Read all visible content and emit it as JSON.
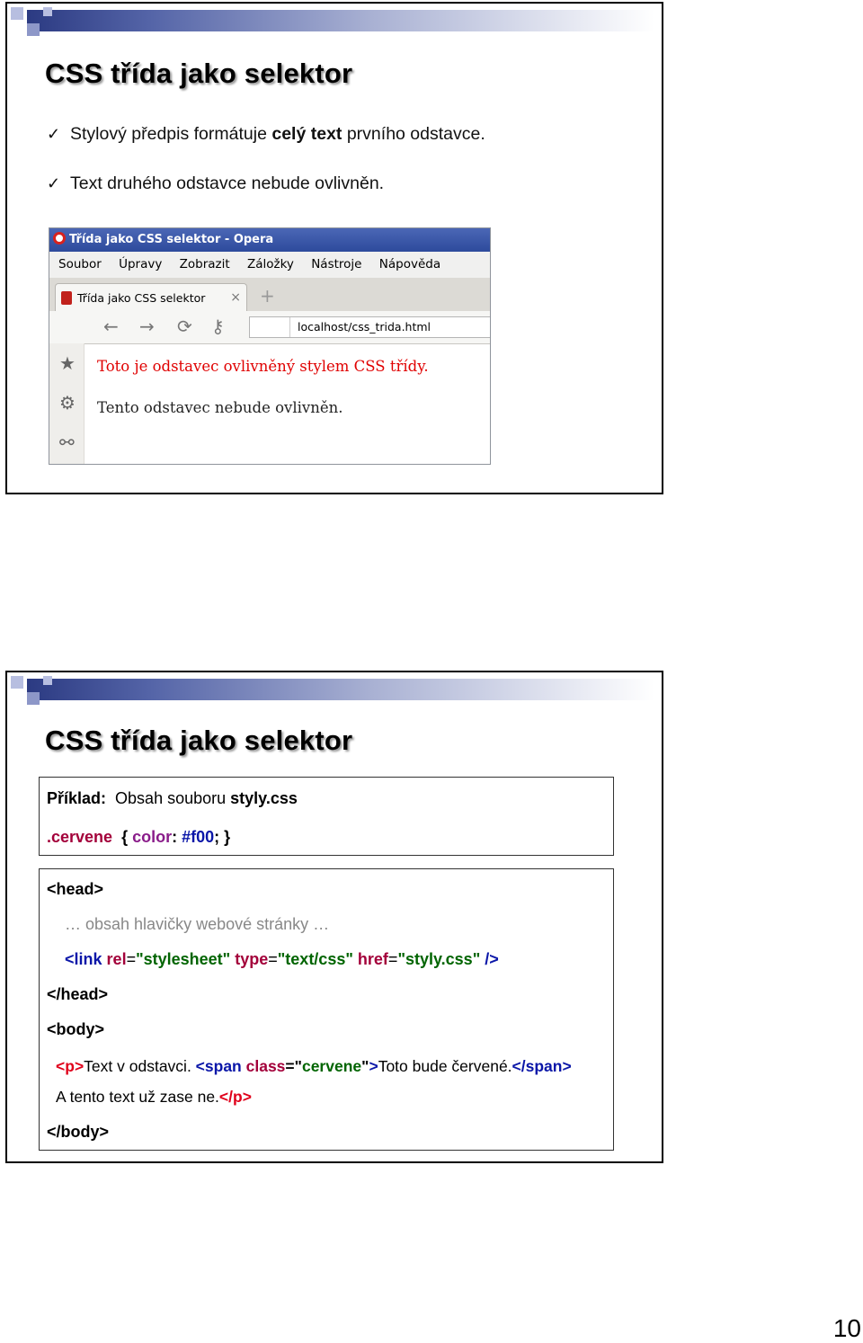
{
  "slide1": {
    "title": "CSS třída jako selektor",
    "bullet1": {
      "check": "✓",
      "pre": "Stylový předpis formátuje ",
      "bold": "celý text",
      "post": " prvního odstavce."
    },
    "bullet2": {
      "check": "✓",
      "text": "Text druhého odstavce nebude ovlivněn."
    },
    "browser": {
      "window_title": "Třída jako CSS selektor - Opera",
      "menu": [
        "Soubor",
        "Úpravy",
        "Zobrazit",
        "Záložky",
        "Nástroje",
        "Nápověda"
      ],
      "tab_label": "Třída jako CSS selektor",
      "tab_close": "×",
      "tab_new": "+",
      "address": "localhost/css_trida.html",
      "nav_icons": {
        "back": "←",
        "forward": "→",
        "reload": "⟳",
        "key": "⚷"
      },
      "side_icons": {
        "star": "★",
        "gear": "⚙",
        "share": "⚯"
      },
      "para_red": "Toto je odstavec ovlivněný stylem CSS třídy.",
      "para_normal": "Tento odstavec nebude ovlivněn."
    }
  },
  "slide2": {
    "title": "CSS třída jako selektor",
    "example": {
      "label": "Příklad:",
      "desc": "Obsah souboru ",
      "file": "styly.css",
      "css_selector": ".cervene",
      "css_open": "{",
      "css_prop": "color",
      "css_colon": ":",
      "css_value": "#f00",
      "css_close": "; }"
    },
    "code": {
      "head_open": "<head>",
      "comment": "… obsah hlavičky webové stránky …",
      "link": {
        "open": "<link",
        "rel_attr": "rel",
        "rel_val": "\"stylesheet\"",
        "type_attr": "type",
        "type_val": "\"text/css\"",
        "href_attr": "href",
        "href_val": "\"styly.css\"",
        "close": "/>",
        "eq": "="
      },
      "head_close": "</head>",
      "body_open": "<body>",
      "p_line": {
        "p_open_lt": "<",
        "p_tag": "p",
        "p_open_gt": ">",
        "text1": "Text v odstavci. ",
        "span_open": "<span",
        "class_attr": "class",
        "eq": "=",
        "q1": "\"",
        "class_val": "cervene",
        "q2": "\"",
        "span_gt": ">",
        "span_text": "Toto bude červené.",
        "span_close": "</span>"
      },
      "p_line2": {
        "text": "A tento text už zase ne.",
        "p_close": "</p>"
      },
      "body_close": "</body>"
    }
  },
  "page_number": "10",
  "colors": {
    "accent_bar": "#2b3a82",
    "red_text": "#e00000",
    "tag_blue": "#0a16a8"
  }
}
